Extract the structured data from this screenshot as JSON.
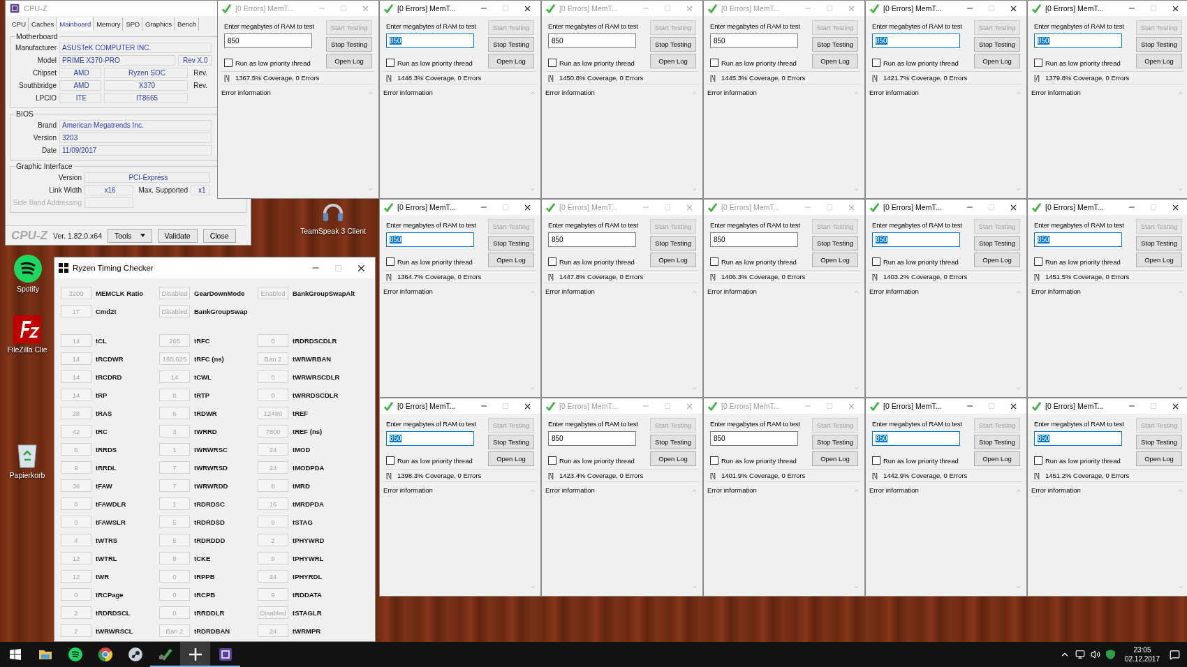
{
  "cpuz": {
    "title": "CPU-Z",
    "tabs": [
      {
        "label": "CPU",
        "selected": false
      },
      {
        "label": "Caches",
        "selected": false
      },
      {
        "label": "Mainboard",
        "selected": true
      },
      {
        "label": "Memory",
        "selected": false
      },
      {
        "label": "SPD",
        "selected": false
      },
      {
        "label": "Graphics",
        "selected": false
      },
      {
        "label": "Bench",
        "selected": false
      }
    ],
    "motherboard": {
      "title": "Motherboard",
      "manufacturer": {
        "label": "Manufacturer",
        "value": "ASUSTeK COMPUTER INC."
      },
      "model": {
        "label": "Model",
        "value": "PRIME X370-PRO",
        "revision": "Rev X.0"
      },
      "bridges": [
        {
          "label": "Chipset",
          "vendor": "AMD",
          "name": "Ryzen SOC",
          "rev_label": "Rev."
        },
        {
          "label": "Southbridge",
          "vendor": "AMD",
          "name": "X370",
          "rev_label": "Rev."
        }
      ],
      "lpcio": {
        "label": "LPCIO",
        "vendor": "ITE",
        "name": "IT8665"
      }
    },
    "bios": {
      "title": "BIOS",
      "fields": [
        {
          "label": "Brand",
          "value": "American Megatrends Inc."
        },
        {
          "label": "Version",
          "value": "3203"
        },
        {
          "label": "Date",
          "value": "11/09/2017"
        }
      ]
    },
    "graphic_interface": {
      "title": "Graphic Interface",
      "version": {
        "label": "Version",
        "value": "PCI-Express"
      },
      "link_width": {
        "label": "Link Width",
        "value": "x16"
      },
      "max_supported": {
        "label": "Max. Supported",
        "value": "x1"
      },
      "side_band": {
        "label": "Side Band Addressing",
        "disabled": true
      }
    },
    "footer": {
      "logo": "CPU-Z",
      "version": "Ver. 1.82.0.x64",
      "buttons": [
        {
          "label": "Tools",
          "dropdown": true
        },
        {
          "label": "Validate",
          "dropdown": false
        },
        {
          "label": "Close",
          "dropdown": false
        }
      ]
    }
  },
  "desktop_icons": [
    {
      "kind": "teamspeak",
      "label": "TeamSpeak 3 Client"
    },
    {
      "kind": "spotify",
      "label": "Spotify"
    },
    {
      "kind": "filezilla",
      "label": "FileZilla Clie"
    },
    {
      "kind": "recycle-bin",
      "label": "Papierkorb"
    }
  ],
  "ryzen_timing_checker": {
    "title": "Ryzen Timing Checker",
    "settings": [
      {
        "cells": [
          {
            "value": "3200",
            "label": "MEMCLK Ratio"
          },
          {
            "value": "Disabled",
            "label": "GearDownMode"
          },
          {
            "value": "Enabled",
            "label": "BankGroupSwapAlt"
          }
        ]
      },
      {
        "cells": [
          {
            "value": "1T",
            "label": "Cmd2t"
          },
          {
            "value": "Disabled",
            "label": "BankGroupSwap"
          }
        ]
      }
    ],
    "timings": [
      {
        "cells": [
          {
            "value": "14",
            "label": "tCL"
          },
          {
            "value": "265",
            "label": "tRFC"
          },
          {
            "value": "0",
            "label": "tRDRDSCDLR"
          }
        ]
      },
      {
        "cells": [
          {
            "value": "14",
            "label": "tRCDWR"
          },
          {
            "value": "165.625",
            "label": "tRFC (ns)"
          },
          {
            "value": "Ban 2",
            "label": "tWRWRBAN"
          }
        ]
      },
      {
        "cells": [
          {
            "value": "14",
            "label": "tRCDRD"
          },
          {
            "value": "14",
            "label": "tCWL"
          },
          {
            "value": "0",
            "label": "tWRWRSCDLR"
          }
        ]
      },
      {
        "cells": [
          {
            "value": "14",
            "label": "tRP"
          },
          {
            "value": "8",
            "label": "tRTP"
          },
          {
            "value": "0",
            "label": "tWRRDSCDLR"
          }
        ]
      },
      {
        "cells": [
          {
            "value": "28",
            "label": "tRAS"
          },
          {
            "value": "6",
            "label": "tRDWR"
          },
          {
            "value": "12480",
            "label": "tREF"
          }
        ]
      },
      {
        "cells": [
          {
            "value": "42",
            "label": "tRC"
          },
          {
            "value": "3",
            "label": "tWRRD"
          },
          {
            "value": "7800",
            "label": "tREF (ns)"
          }
        ]
      },
      {
        "cells": [
          {
            "value": "6",
            "label": "tRRDS"
          },
          {
            "value": "1",
            "label": "tWRWRSC"
          },
          {
            "value": "24",
            "label": "tMOD"
          }
        ]
      },
      {
        "cells": [
          {
            "value": "9",
            "label": "tRRDL"
          },
          {
            "value": "7",
            "label": "tWRWRSD"
          },
          {
            "value": "24",
            "label": "tMODPDA"
          }
        ]
      },
      {
        "cells": [
          {
            "value": "36",
            "label": "tFAW"
          },
          {
            "value": "7",
            "label": "tWRWRDD"
          },
          {
            "value": "8",
            "label": "tMRD"
          }
        ]
      },
      {
        "cells": [
          {
            "value": "0",
            "label": "tFAWDLR"
          },
          {
            "value": "1",
            "label": "tRDRDSC"
          },
          {
            "value": "16",
            "label": "tMRDPDA"
          }
        ]
      },
      {
        "cells": [
          {
            "value": "0",
            "label": "tFAWSLR"
          },
          {
            "value": "5",
            "label": "tRDRDSD"
          },
          {
            "value": "9",
            "label": "tSTAG"
          }
        ]
      },
      {
        "cells": [
          {
            "value": "4",
            "label": "tWTRS"
          },
          {
            "value": "5",
            "label": "tRDRDDD"
          },
          {
            "value": "2",
            "label": "tPHYWRD"
          }
        ]
      },
      {
        "cells": [
          {
            "value": "12",
            "label": "tWTRL"
          },
          {
            "value": "8",
            "label": "tCKE"
          },
          {
            "value": "9",
            "label": "tPHYWRL"
          }
        ]
      },
      {
        "cells": [
          {
            "value": "12",
            "label": "tWR"
          },
          {
            "value": "0",
            "label": "tRPPB"
          },
          {
            "value": "24",
            "label": "tPHYRDL"
          }
        ]
      },
      {
        "cells": [
          {
            "value": "0",
            "label": "tRCPage"
          },
          {
            "value": "0",
            "label": "tRCPB"
          },
          {
            "value": "9",
            "label": "tRDDATA"
          }
        ]
      },
      {
        "cells": [
          {
            "value": "2",
            "label": "tRDRDSCL"
          },
          {
            "value": "0",
            "label": "tRRDDLR"
          },
          {
            "value": "Disabled",
            "label": "tSTAGLR"
          }
        ]
      },
      {
        "cells": [
          {
            "value": "2",
            "label": "tWRWRSCL"
          },
          {
            "value": "Ban 2",
            "label": "tRDRDBAN"
          },
          {
            "value": "24",
            "label": "tWRMPR"
          }
        ]
      }
    ]
  },
  "memtest_windows": [
    {
      "title": "[0 Errors] MemT...",
      "focused": false,
      "prompt": "Enter megabytes of RAM to test",
      "ram": "850",
      "buttons": [
        {
          "label": "Start Testing",
          "disabled": true
        },
        {
          "label": "Stop Testing",
          "disabled": false
        },
        {
          "label": "Open Log",
          "disabled": false
        }
      ],
      "low_priority": {
        "label": "Run as low priority thread",
        "checked": false
      },
      "spinner": "[\\]",
      "coverage": "1367.5% Coverage, 0 Errors",
      "log_title": "Error information"
    },
    {
      "title": "[0 Errors] MemT...",
      "focused": true,
      "prompt": "Enter megabytes of RAM to test",
      "ram": "850",
      "buttons": [
        {
          "label": "Start Testing",
          "disabled": true
        },
        {
          "label": "Stop Testing",
          "disabled": false
        },
        {
          "label": "Open Log",
          "disabled": false
        }
      ],
      "low_priority": {
        "label": "Run as low priority thread",
        "checked": false
      },
      "spinner": "[\\]",
      "coverage": "1448.3% Coverage, 0 Errors",
      "log_title": "Error information"
    },
    {
      "title": "[0 Errors] MemT...",
      "focused": false,
      "prompt": "Enter megabytes of RAM to test",
      "ram": "850",
      "buttons": [
        {
          "label": "Start Testing",
          "disabled": true
        },
        {
          "label": "Stop Testing",
          "disabled": false
        },
        {
          "label": "Open Log",
          "disabled": false
        }
      ],
      "low_priority": {
        "label": "Run as low priority thread",
        "checked": false
      },
      "spinner": "[\\]",
      "coverage": "1450.8% Coverage, 0 Errors",
      "log_title": "Error information"
    },
    {
      "title": "[0 Errors] MemT...",
      "focused": false,
      "prompt": "Enter megabytes of RAM to test",
      "ram": "850",
      "buttons": [
        {
          "label": "Start Testing",
          "disabled": true
        },
        {
          "label": "Stop Testing",
          "disabled": false
        },
        {
          "label": "Open Log",
          "disabled": false
        }
      ],
      "low_priority": {
        "label": "Run as low priority thread",
        "checked": false
      },
      "spinner": "[\\]",
      "coverage": "1445.3% Coverage, 0 Errors",
      "log_title": "Error information"
    },
    {
      "title": "[0 Errors] MemT...",
      "focused": true,
      "prompt": "Enter megabytes of RAM to test",
      "ram": "850",
      "buttons": [
        {
          "label": "Start Testing",
          "disabled": true
        },
        {
          "label": "Stop Testing",
          "disabled": false
        },
        {
          "label": "Open Log",
          "disabled": false
        }
      ],
      "low_priority": {
        "label": "Run as low priority thread",
        "checked": false
      },
      "spinner": "[\\]",
      "coverage": "1421.7% Coverage, 0 Errors",
      "log_title": "Error information"
    },
    {
      "title": "[0 Errors] MemT...",
      "focused": true,
      "prompt": "Enter megabytes of RAM to test",
      "ram": "850",
      "buttons": [
        {
          "label": "Start Testing",
          "disabled": true
        },
        {
          "label": "Stop Testing",
          "disabled": false
        },
        {
          "label": "Open Log",
          "disabled": false
        }
      ],
      "low_priority": {
        "label": "Run as low priority thread",
        "checked": false
      },
      "spinner": "[/]",
      "coverage": "1379.8% Coverage, 0 Errors",
      "log_title": "Error information"
    },
    {
      "title": "[0 Errors] MemT...",
      "focused": true,
      "prompt": "Enter megabytes of RAM to test",
      "ram": "850",
      "buttons": [
        {
          "label": "Start Testing",
          "disabled": true
        },
        {
          "label": "Stop Testing",
          "disabled": false
        },
        {
          "label": "Open Log",
          "disabled": false
        }
      ],
      "low_priority": {
        "label": "Run as low priority thread",
        "checked": false
      },
      "spinner": "[\\]",
      "coverage": "1364.7% Coverage, 0 Errors",
      "log_title": "Error information"
    },
    {
      "title": "[0 Errors] MemT...",
      "focused": false,
      "prompt": "Enter megabytes of RAM to test",
      "ram": "850",
      "buttons": [
        {
          "label": "Start Testing",
          "disabled": true
        },
        {
          "label": "Stop Testing",
          "disabled": false
        },
        {
          "label": "Open Log",
          "disabled": false
        }
      ],
      "low_priority": {
        "label": "Run as low priority thread",
        "checked": false
      },
      "spinner": "[\\]",
      "coverage": "1447.8% Coverage, 0 Errors",
      "log_title": "Error information"
    },
    {
      "title": "[0 Errors] MemT...",
      "focused": false,
      "prompt": "Enter megabytes of RAM to test",
      "ram": "850",
      "buttons": [
        {
          "label": "Start Testing",
          "disabled": true
        },
        {
          "label": "Stop Testing",
          "disabled": false
        },
        {
          "label": "Open Log",
          "disabled": false
        }
      ],
      "low_priority": {
        "label": "Run as low priority thread",
        "checked": false
      },
      "spinner": "[\\]",
      "coverage": "1406.3% Coverage, 0 Errors",
      "log_title": "Error information"
    },
    {
      "title": "[0 Errors] MemT...",
      "focused": true,
      "prompt": "Enter megabytes of RAM to test",
      "ram": "850",
      "buttons": [
        {
          "label": "Start Testing",
          "disabled": true
        },
        {
          "label": "Stop Testing",
          "disabled": false
        },
        {
          "label": "Open Log",
          "disabled": false
        }
      ],
      "low_priority": {
        "label": "Run as low priority thread",
        "checked": false
      },
      "spinner": "[\\]",
      "coverage": "1403.2% Coverage, 0 Errors",
      "log_title": "Error information"
    },
    {
      "title": "[0 Errors] MemT...",
      "focused": true,
      "prompt": "Enter megabytes of RAM to test",
      "ram": "850",
      "buttons": [
        {
          "label": "Start Testing",
          "disabled": true
        },
        {
          "label": "Stop Testing",
          "disabled": false
        },
        {
          "label": "Open Log",
          "disabled": false
        }
      ],
      "low_priority": {
        "label": "Run as low priority thread",
        "checked": false
      },
      "spinner": "[\\]",
      "coverage": "1451.5% Coverage, 0 Errors",
      "log_title": "Error information"
    },
    {
      "title": "[0 Errors] MemT...",
      "focused": true,
      "prompt": "Enter megabytes of RAM to test",
      "ram": "850",
      "buttons": [
        {
          "label": "Start Testing",
          "disabled": true
        },
        {
          "label": "Stop Testing",
          "disabled": false
        },
        {
          "label": "Open Log",
          "disabled": false
        }
      ],
      "low_priority": {
        "label": "Run as low priority thread",
        "checked": false
      },
      "spinner": "[\\]",
      "coverage": "1398.3% Coverage, 0 Errors",
      "log_title": "Error information"
    },
    {
      "title": "[0 Errors] MemT...",
      "focused": false,
      "prompt": "Enter megabytes of RAM to test",
      "ram": "850",
      "buttons": [
        {
          "label": "Start Testing",
          "disabled": true
        },
        {
          "label": "Stop Testing",
          "disabled": false
        },
        {
          "label": "Open Log",
          "disabled": false
        }
      ],
      "low_priority": {
        "label": "Run as low priority thread",
        "checked": false
      },
      "spinner": "[\\]",
      "coverage": "1423.4% Coverage, 0 Errors",
      "log_title": "Error information"
    },
    {
      "title": "[0 Errors] MemT...",
      "focused": false,
      "prompt": "Enter megabytes of RAM to test",
      "ram": "850",
      "buttons": [
        {
          "label": "Start Testing",
          "disabled": true
        },
        {
          "label": "Stop Testing",
          "disabled": false
        },
        {
          "label": "Open Log",
          "disabled": false
        }
      ],
      "low_priority": {
        "label": "Run as low priority thread",
        "checked": false
      },
      "spinner": "[\\]",
      "coverage": "1401.9% Coverage, 0 Errors",
      "log_title": "Error information"
    },
    {
      "title": "[0 Errors] MemT...",
      "focused": true,
      "prompt": "Enter megabytes of RAM to test",
      "ram": "850",
      "buttons": [
        {
          "label": "Start Testing",
          "disabled": true
        },
        {
          "label": "Stop Testing",
          "disabled": false
        },
        {
          "label": "Open Log",
          "disabled": false
        }
      ],
      "low_priority": {
        "label": "Run as low priority thread",
        "checked": false
      },
      "spinner": "[\\]",
      "coverage": "1442.9% Coverage, 0 Errors",
      "log_title": "Error information"
    },
    {
      "title": "[0 Errors] MemT...",
      "focused": true,
      "prompt": "Enter megabytes of RAM to test",
      "ram": "850",
      "buttons": [
        {
          "label": "Start Testing",
          "disabled": true
        },
        {
          "label": "Stop Testing",
          "disabled": false
        },
        {
          "label": "Open Log",
          "disabled": false
        }
      ],
      "low_priority": {
        "label": "Run as low priority thread",
        "checked": false
      },
      "spinner": "[\\]",
      "coverage": "1451.2% Coverage, 0 Errors",
      "log_title": "Error information"
    }
  ],
  "taskbar": {
    "apps": [
      {
        "kind": "explorer",
        "running": false,
        "selected": false
      },
      {
        "kind": "spotify",
        "running": false,
        "selected": false
      },
      {
        "kind": "chrome",
        "running": false,
        "selected": false
      },
      {
        "kind": "steam",
        "running": false,
        "selected": false
      },
      {
        "kind": "memtest",
        "running": true,
        "selected": false
      },
      {
        "kind": "ryzen",
        "running": true,
        "selected": true
      },
      {
        "kind": "cpuz",
        "running": true,
        "selected": false
      }
    ],
    "clock": {
      "time": "23:05",
      "date": "02.12.2017"
    }
  }
}
